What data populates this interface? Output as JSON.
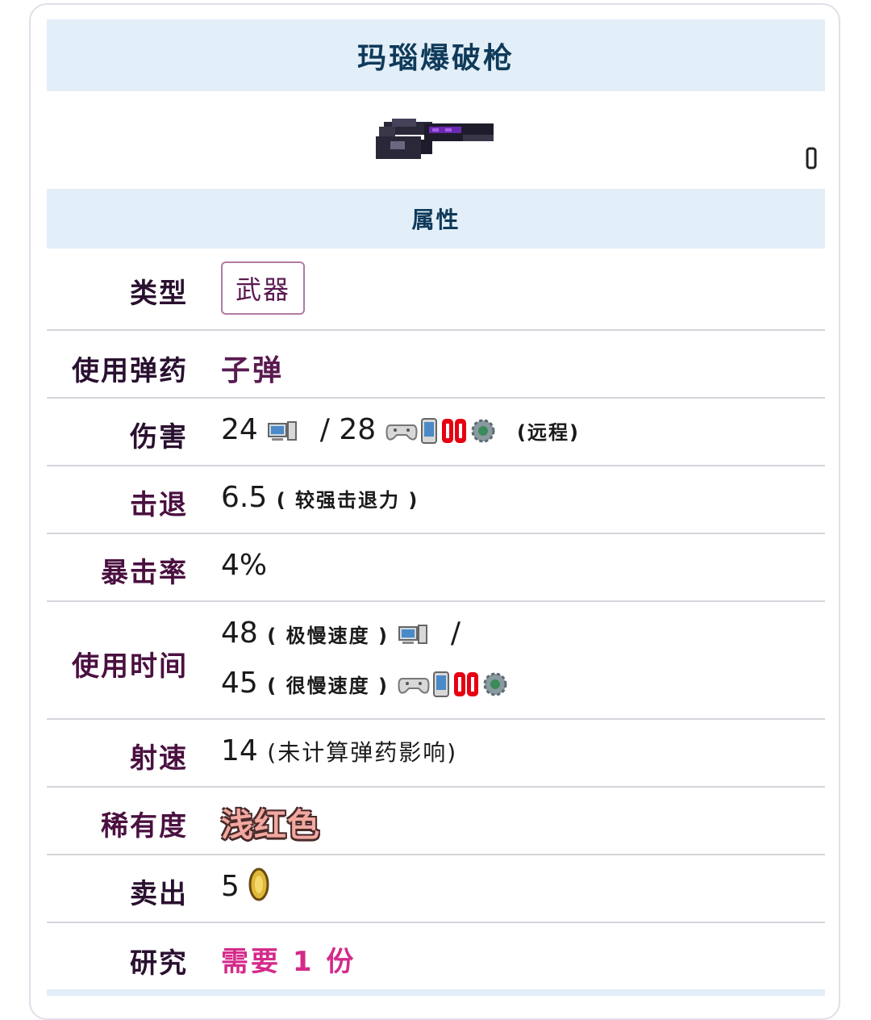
{
  "item": {
    "title": "玛瑙爆破枪",
    "section_header": "属性"
  },
  "properties": {
    "type": {
      "label": "类型",
      "value": "武器"
    },
    "ammo": {
      "label": "使用弹药",
      "value": "子弹"
    },
    "damage": {
      "label": "伤害",
      "pc_value": "24",
      "separator": "/",
      "console_value": "28",
      "class_note": "(远程)"
    },
    "knockback": {
      "label": "击退",
      "value": "6.5",
      "note": "( 较强击退力 )"
    },
    "crit": {
      "label": "暴击率",
      "value": "4%"
    },
    "use_time": {
      "label": "使用时间",
      "pc_value": "48",
      "pc_note": "( 极慢速度 )",
      "separator": "/",
      "console_value": "45",
      "console_note": "( 很慢速度 )"
    },
    "velocity": {
      "label": "射速",
      "value": "14",
      "note": "(未计算弹药影响)"
    },
    "rarity": {
      "label": "稀有度",
      "value": "浅红色"
    },
    "sell": {
      "label": "卖出",
      "value": "5"
    },
    "research": {
      "label": "研究",
      "value": "需要 1 份"
    }
  },
  "icons": {
    "gun": "onyx-blaster-icon",
    "pc": "pc-platform-icon",
    "console": "console-platform-icon",
    "mobile": "mobile-platform-icon",
    "switch": "switch-platform-icon",
    "tmodloader": "gear-platform-icon",
    "coin": "gold-coin-icon"
  },
  "colors": {
    "header_bg": "#e2eef8",
    "header_text": "#0f3a5a",
    "label_text": "#4a1040",
    "research_text": "#d42a8a",
    "rarity_text": "#f2a8a0"
  }
}
